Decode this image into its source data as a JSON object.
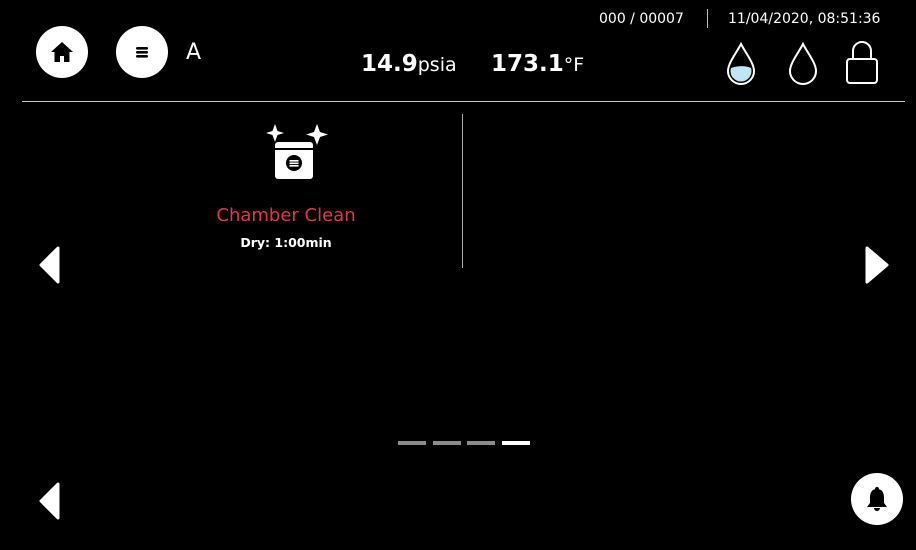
{
  "header": {
    "profile_letter": "A",
    "counter": "000 / 00007",
    "datetime": "11/04/2020, 08:51:36",
    "pressure": {
      "value": "14.9",
      "unit": "psia"
    },
    "temperature": {
      "value": "173.1",
      "unit": "°F"
    },
    "status_icons": [
      "water-full-icon",
      "water-empty-icon",
      "lock-icon"
    ]
  },
  "cycles": [
    {
      "title": "Chamber Clean",
      "subtitle": "Dry: 1:00min",
      "icon": "chamber-clean-icon"
    }
  ],
  "pagination": {
    "total": 4,
    "active": 4
  },
  "colors": {
    "background": "#000000",
    "accent_red": "#e4354a",
    "water_fill": "#bfe6f5",
    "page_inactive": "#8a8a8a",
    "page_active": "#ffffff"
  }
}
